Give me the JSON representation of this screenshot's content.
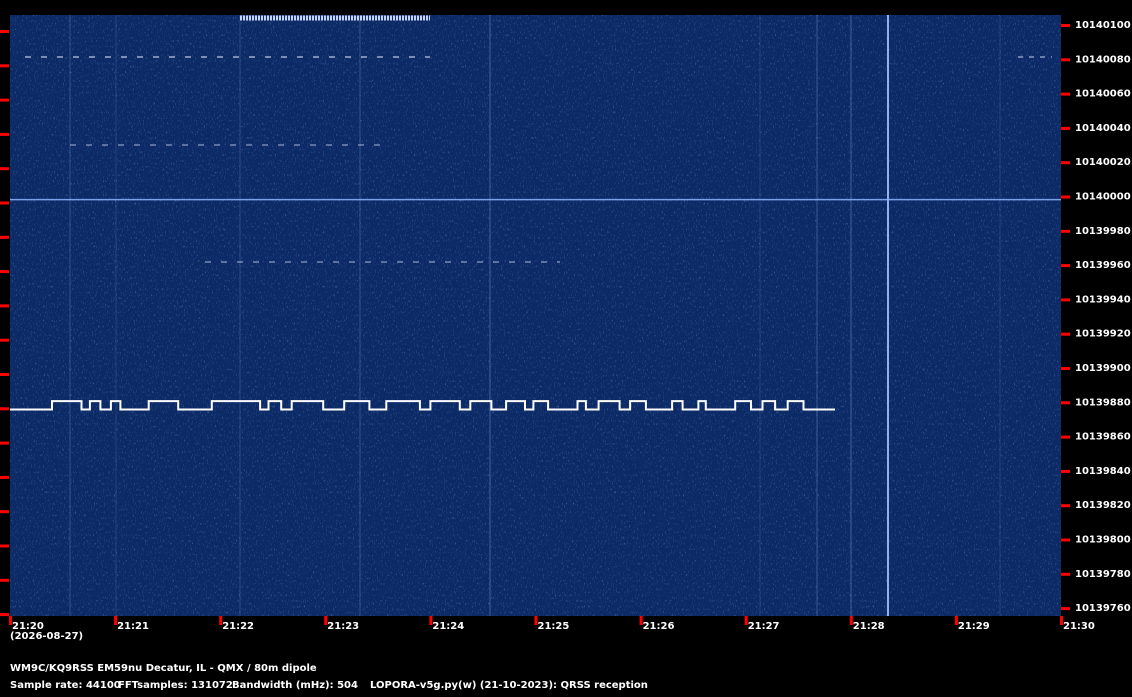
{
  "colors": {
    "background": "#000000",
    "waterfall": "#0b2a66",
    "tick": "#ff0000",
    "signal": "#ffffff",
    "text": "#ffffff"
  },
  "date_label": "(2026-08-27)",
  "info": {
    "station": "WM9C/KQ9RSS EM59nu Decatur, IL - QMX / 80m dipole",
    "sample_rate": "Sample rate: 44100",
    "fft_samples": "FFTsamples: 131072",
    "bandwidth": "Bandwidth (mHz): 504",
    "software": "LOPORA-v5g.py(w) (21-10-2023): QRSS reception"
  },
  "chart_data": {
    "type": "heatmap",
    "x_ticks": [
      "21:20",
      "21:21",
      "21:22",
      "21:23",
      "21:24",
      "21:25",
      "21:26",
      "21:27",
      "21:28",
      "21:29",
      "21:30"
    ],
    "y_ticks": [
      "10140100",
      "10140080",
      "10140060",
      "10140040",
      "10140020",
      "10140000",
      "10139980",
      "10139960",
      "10139940",
      "10139920",
      "10139900",
      "10139880",
      "10139860",
      "10139840",
      "10139820",
      "10139800",
      "10139780",
      "10139760"
    ],
    "x_range_minutes": [
      0,
      10
    ],
    "y_range_hz": [
      10139752,
      10140110
    ],
    "carrier_hz": 10140000,
    "fsk_signal": {
      "base_hz": 10139875,
      "mark_hz": 10139880,
      "start_min": 0.0,
      "end_min": 7.85,
      "keying": [
        [
          0.0,
          0.4,
          0
        ],
        [
          0.4,
          0.68,
          1
        ],
        [
          0.68,
          0.76,
          0
        ],
        [
          0.76,
          0.86,
          1
        ],
        [
          0.86,
          0.96,
          0
        ],
        [
          0.96,
          1.05,
          1
        ],
        [
          1.05,
          1.32,
          0
        ],
        [
          1.32,
          1.6,
          1
        ],
        [
          1.6,
          1.7,
          0
        ],
        [
          1.7,
          1.92,
          0
        ],
        [
          1.92,
          2.38,
          1
        ],
        [
          2.38,
          2.46,
          0
        ],
        [
          2.46,
          2.58,
          1
        ],
        [
          2.58,
          2.68,
          0
        ],
        [
          2.68,
          2.98,
          1
        ],
        [
          2.98,
          3.18,
          0
        ],
        [
          3.18,
          3.42,
          1
        ],
        [
          3.42,
          3.58,
          0
        ],
        [
          3.58,
          3.9,
          1
        ],
        [
          3.9,
          4.0,
          0
        ],
        [
          4.0,
          4.28,
          1
        ],
        [
          4.28,
          4.38,
          0
        ],
        [
          4.38,
          4.58,
          1
        ],
        [
          4.58,
          4.72,
          0
        ],
        [
          4.72,
          4.9,
          1
        ],
        [
          4.9,
          4.98,
          0
        ],
        [
          4.98,
          5.12,
          1
        ],
        [
          5.12,
          5.4,
          0
        ],
        [
          5.4,
          5.48,
          1
        ],
        [
          5.48,
          5.6,
          0
        ],
        [
          5.6,
          5.8,
          1
        ],
        [
          5.8,
          5.9,
          0
        ],
        [
          5.9,
          6.05,
          1
        ],
        [
          6.05,
          6.3,
          0
        ],
        [
          6.3,
          6.4,
          1
        ],
        [
          6.4,
          6.55,
          0
        ],
        [
          6.55,
          6.62,
          1
        ],
        [
          6.62,
          6.78,
          0
        ],
        [
          6.78,
          6.9,
          0
        ],
        [
          6.9,
          7.05,
          1
        ],
        [
          7.05,
          7.16,
          0
        ],
        [
          7.16,
          7.28,
          1
        ],
        [
          7.28,
          7.4,
          0
        ],
        [
          7.4,
          7.55,
          1
        ],
        [
          7.55,
          7.85,
          0
        ]
      ]
    }
  }
}
